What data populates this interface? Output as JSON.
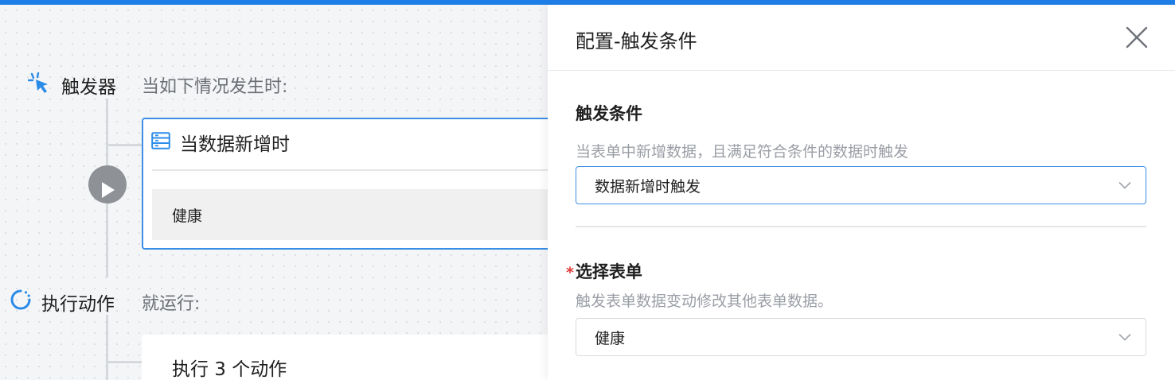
{
  "canvas": {
    "trigger_section": {
      "title": "触发器",
      "subtitle": "当如下情况发生时:",
      "icon": "cursor-click-icon"
    },
    "trigger_card": {
      "icon": "form-icon",
      "title": "当数据新增时",
      "value": "健康"
    },
    "play_icon": "play-icon",
    "action_section": {
      "title": "执行动作",
      "subtitle": "就运行:",
      "icon": "loading-icon"
    },
    "action_card": {
      "text": "执行 3 个动作"
    }
  },
  "panel": {
    "title": "配置-触发条件",
    "close_icon": "close-icon",
    "trigger_condition": {
      "label": "触发条件",
      "description": "当表单中新增数据，且满足符合条件的数据时触发",
      "selected": "数据新增时触发"
    },
    "select_form": {
      "required_mark": "*",
      "label": "选择表单",
      "description": "触发表单数据变动修改其他表单数据。",
      "selected": "健康"
    }
  },
  "colors": {
    "accent": "#1f7fe8",
    "focus_border": "#3a8ee6",
    "required": "#e03a3a",
    "muted_text": "#9a9ea5",
    "play_button": "#8e9196"
  }
}
